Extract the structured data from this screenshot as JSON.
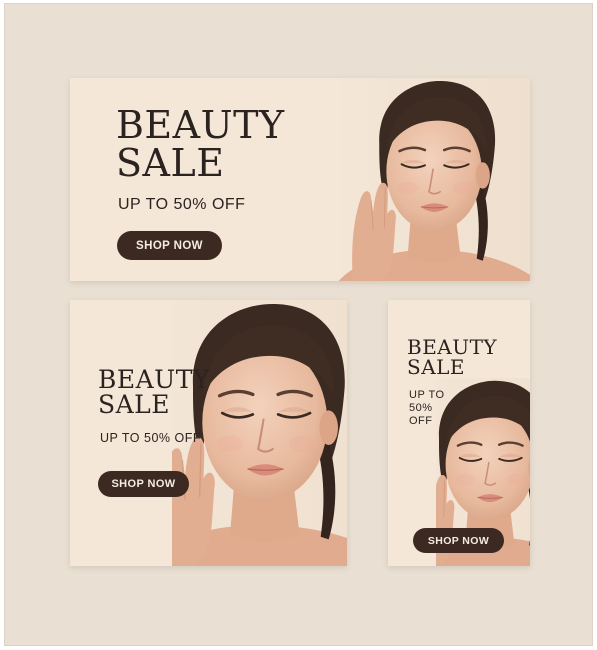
{
  "banners": {
    "wide": {
      "headline_line1": "BEAUTY",
      "headline_line2": "SALE",
      "subheadline": "UP TO 50% OFF",
      "cta_label": "SHOP NOW"
    },
    "square": {
      "headline_line1": "BEAUTY",
      "headline_line2": "SALE",
      "subheadline": "UP TO 50% OFF",
      "cta_label": "SHOP NOW"
    },
    "tall": {
      "headline_line1": "BEAUTY",
      "headline_line2": "SALE",
      "subheadline": "UP TO 50% OFF",
      "cta_label": "SHOP NOW"
    }
  },
  "colors": {
    "background": "#e9dfd2",
    "banner": "#f4e7d8",
    "text": "#2b2320",
    "button": "#3c2a22",
    "button_text": "#f6ebdf"
  }
}
